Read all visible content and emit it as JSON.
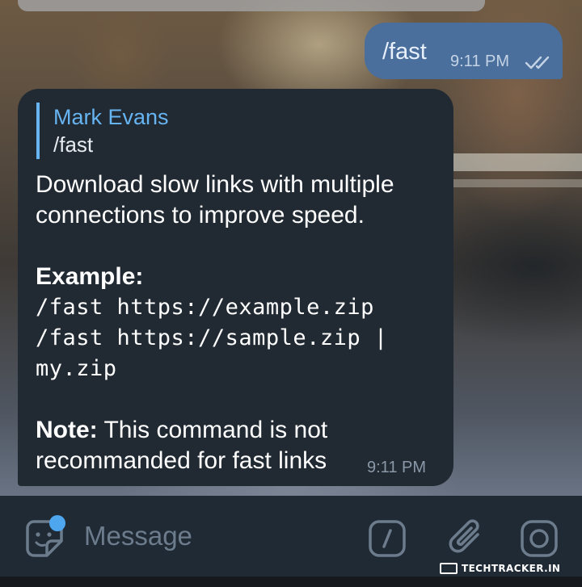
{
  "outgoing": {
    "text": "/fast",
    "time": "9:11 PM",
    "status_icon": "double-check-icon"
  },
  "incoming": {
    "reply": {
      "name": "Mark Evans",
      "text": "/fast"
    },
    "description": "Download slow links with multiple connections to improve speed.",
    "example_label": "Example:",
    "example_lines": [
      "/fast https://example.zip",
      "/fast https://sample.zip |",
      "my.zip"
    ],
    "note_label": "Note:",
    "note_text": " This command is not recommanded for fast links",
    "time": "9:11 PM"
  },
  "composer": {
    "placeholder": "Message",
    "icons": [
      "sticker-icon",
      "bot-command-icon",
      "paperclip-icon",
      "camera-icon"
    ],
    "accent_color": "#4ea6ef"
  },
  "watermark": {
    "text": "TechTracker.in"
  },
  "colors": {
    "outgoing_bubble": "#4a6f9c",
    "incoming_bubble": "#212a33",
    "link_accent": "#66b4f2"
  }
}
